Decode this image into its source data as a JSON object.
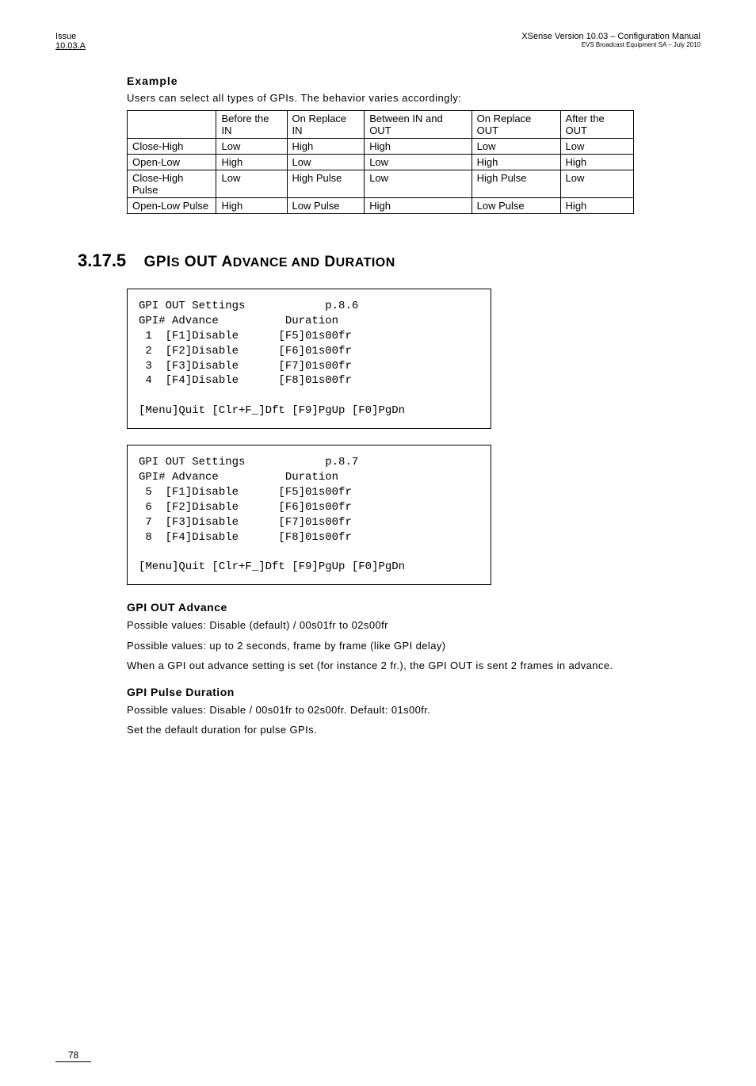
{
  "header": {
    "issue_label": "Issue",
    "issue_num": "10.03.A",
    "right_line1": "XSense    Version 10.03 – Configuration Manual",
    "right_line2": "EVS Broadcast Equipment SA – July 2010"
  },
  "example": {
    "title": "Example",
    "intro": "Users can select all types of GPIs. The behavior varies accordingly:"
  },
  "table": {
    "headers": [
      "",
      "Before the IN",
      "On Replace IN",
      "Between IN and OUT",
      "On Replace OUT",
      "After the OUT"
    ],
    "rows": [
      {
        "label": "Close-High",
        "c1": "Low",
        "c2": "High",
        "c3": "High",
        "c4": "Low",
        "c5": "Low"
      },
      {
        "label": "Open-Low",
        "c1": "High",
        "c2": "Low",
        "c3": "Low",
        "c4": "High",
        "c5": "High"
      },
      {
        "label": "Close-High Pulse",
        "c1": "Low",
        "c2": "High Pulse",
        "c3": "Low",
        "c4": "High Pulse",
        "c5": "Low"
      },
      {
        "label": "Open-Low Pulse",
        "c1": "High",
        "c2": "Low Pulse",
        "c3": "High",
        "c4": "Low Pulse",
        "c5": "High"
      }
    ]
  },
  "section": {
    "num": "3.17.5",
    "title_parts": [
      "GPI",
      "S",
      " OUT A",
      "DVANCE AND ",
      "D",
      "URATION"
    ]
  },
  "box1": "GPI OUT Settings            p.8.6\nGPI# Advance          Duration\n 1  [F1]Disable      [F5]01s00fr\n 2  [F2]Disable      [F6]01s00fr\n 3  [F3]Disable      [F7]01s00fr\n 4  [F4]Disable      [F8]01s00fr\n\n[Menu]Quit [Clr+F_]Dft [F9]PgUp [F0]PgDn",
  "box2": "GPI OUT Settings            p.8.7\nGPI# Advance          Duration\n 5  [F1]Disable      [F5]01s00fr\n 6  [F2]Disable      [F6]01s00fr\n 7  [F3]Disable      [F7]01s00fr\n 8  [F4]Disable      [F8]01s00fr\n\n[Menu]Quit [Clr+F_]Dft [F9]PgUp [F0]PgDn",
  "gpi_advance": {
    "title": "GPI OUT Advance",
    "p1": "Possible values: Disable (default) / 00s01fr to 02s00fr",
    "p2": "Possible values: up to 2 seconds, frame by frame (like GPI delay)",
    "p3": "When a GPI out advance setting is set (for instance 2 fr.), the GPI OUT is sent 2 frames in advance."
  },
  "gpi_pulse": {
    "title": "GPI Pulse Duration",
    "p1": "Possible values:  Disable / 00s01fr to 02s00fr. Default: 01s00fr.",
    "p2": "Set the default duration for pulse GPIs."
  },
  "footer": "78"
}
